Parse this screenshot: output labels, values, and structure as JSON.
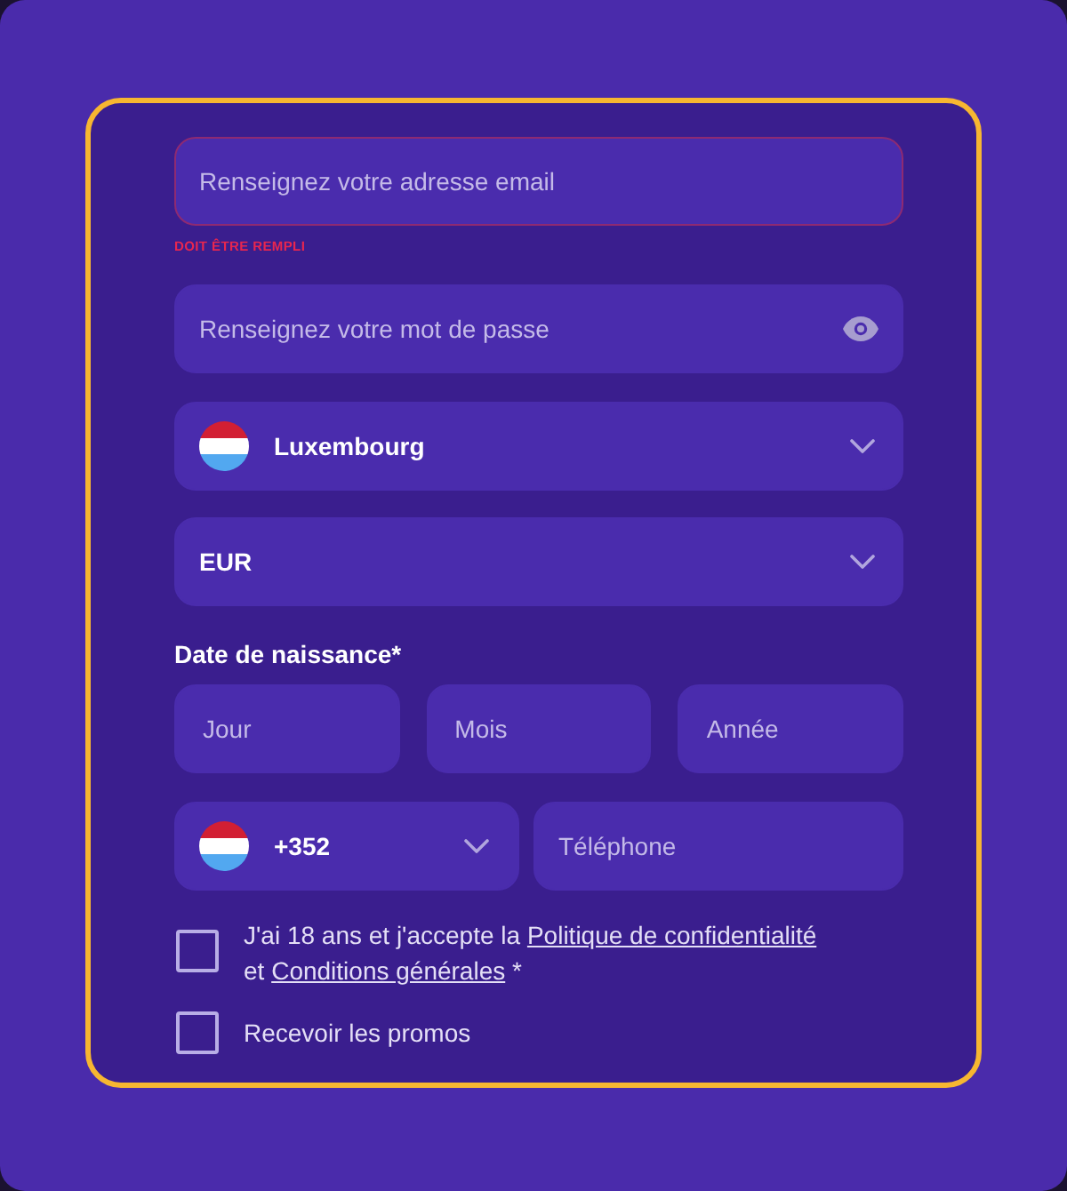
{
  "email_field": {
    "placeholder": "Renseignez votre adresse email",
    "error": true,
    "error_message": "DOIT ÊTRE REMPLI"
  },
  "password_field": {
    "placeholder": "Renseignez votre mot de passe"
  },
  "country_select": {
    "value": "Luxembourg"
  },
  "currency_select": {
    "value": "EUR"
  },
  "birth_date": {
    "label": "Date de naissance*",
    "fields": [
      {
        "placeholder": "Jour"
      },
      {
        "placeholder": "Mois"
      },
      {
        "placeholder": "Année"
      }
    ]
  },
  "phone": {
    "code": "+352",
    "placeholder": "Téléphone"
  },
  "checkboxes": [
    {
      "checked": false,
      "segments": [
        {
          "kind": "text",
          "text": "J'ai 18 ans et j'accepte la "
        },
        {
          "kind": "link",
          "text": "Politique de confidentialité"
        },
        {
          "kind": "text",
          "text": " et "
        },
        {
          "kind": "link",
          "text": "Conditions générales"
        },
        {
          "kind": "text",
          "text": " *"
        }
      ]
    },
    {
      "checked": false,
      "segments": [
        {
          "kind": "text",
          "text": "Recevoir les promos"
        }
      ]
    }
  ]
}
